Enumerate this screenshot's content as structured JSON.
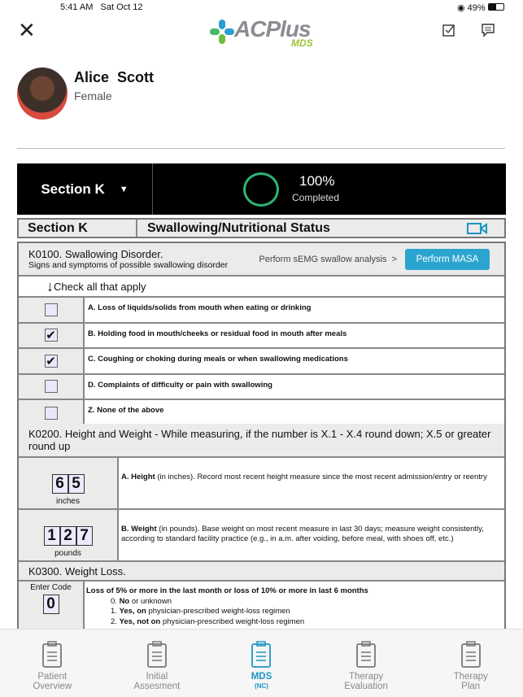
{
  "status_bar": {
    "time": "5:41 AM",
    "date": "Sat Oct 12",
    "battery": "49%"
  },
  "header": {
    "logo": "ACPlus",
    "logo_sub": "MDS",
    "close_icon": "close-icon",
    "icons": [
      "checklist-icon",
      "comment-icon"
    ]
  },
  "patient": {
    "name": "Alice  Scott",
    "gender": "Female"
  },
  "section_bar": {
    "selected": "Section K",
    "progress_percent": 100,
    "progress_label": "100%",
    "progress_text": "Completed",
    "ring_color": "#2db574"
  },
  "section_header": {
    "code": "Section K",
    "title": "Swallowing/Nutritional Status",
    "video_icon": "video-camera-icon"
  },
  "k0100": {
    "title": "K0100. Swallowing Disorder.",
    "subtitle": "Signs and symptoms of possible swallowing disorder",
    "semg_link": "Perform sEMG swallow analysis  >",
    "masa_button": "Perform MASA",
    "instruction": "Check all that apply",
    "items": [
      {
        "label": "A. Loss of liquids/solids from mouth when eating or drinking",
        "checked": false
      },
      {
        "label": "B. Holding food in mouth/cheeks or residual food in mouth after meals",
        "checked": true
      },
      {
        "label": "C. Coughing or choking during meals or when swallowing medications",
        "checked": true
      },
      {
        "label": "D. Complaints of difficulty or pain with swallowing",
        "checked": false
      },
      {
        "label": "Z. None of the above",
        "checked": false
      }
    ]
  },
  "k0200": {
    "title": "K0200. Height and Weight - While measuring, if the number is X.1 - X.4 round down; X.5 or greater round up",
    "height": {
      "digits": [
        "6",
        "5"
      ],
      "unit": "inches",
      "label_bold": "A. Height",
      "label": " (in inches). Record most recent height measure since the most recent admission/entry or reentry"
    },
    "weight": {
      "digits": [
        "1",
        "2",
        "7"
      ],
      "unit": "pounds",
      "label_bold": "B. Weight",
      "label": " (in pounds). Base weight on most recent measure in last 30 days; measure weight consistently, according to standard facility practice (e.g., in a.m. after voiding, before meal, with shoes off, etc.)"
    }
  },
  "k0300": {
    "title": "K0300. Weight Loss.",
    "enter_code": "Enter Code",
    "code": "0",
    "question": "Loss of 5% or more in the last month or loss of 10% or more in last 6 months",
    "options": [
      {
        "num": "0. ",
        "bold": "No",
        "rest": " or unknown"
      },
      {
        "num": "1. ",
        "bold": "Yes, on",
        "rest": " physician-prescribed weight-loss regimen"
      },
      {
        "num": "2. ",
        "bold": "Yes, not on",
        "rest": " physician-prescribed weight-loss regimen"
      }
    ]
  },
  "nav": [
    {
      "label": "Patient\nOverview"
    },
    {
      "label": "Initial\nAssesment"
    },
    {
      "label": "MDS",
      "sub": "(NC)",
      "active": true
    },
    {
      "label": "Therapy\nEvaluation"
    },
    {
      "label": "Therapy\nPlan"
    }
  ]
}
